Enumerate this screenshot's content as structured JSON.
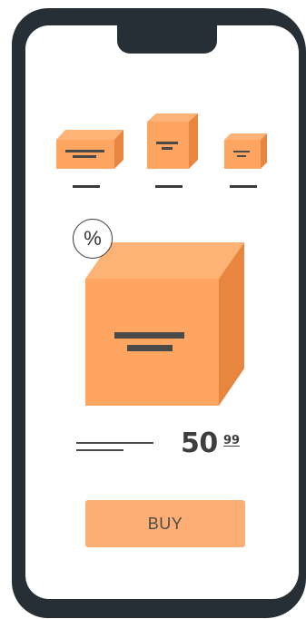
{
  "discount_badge": {
    "symbol": "%"
  },
  "price": {
    "main": "50",
    "cents": "99"
  },
  "buy_button": {
    "label": "BUY"
  },
  "colors": {
    "frame": "#262f35",
    "box_front": "#fda561",
    "box_top": "#fdb276",
    "box_side": "#e8853e",
    "button": "#fdae74",
    "text": "#3e3e3e"
  }
}
